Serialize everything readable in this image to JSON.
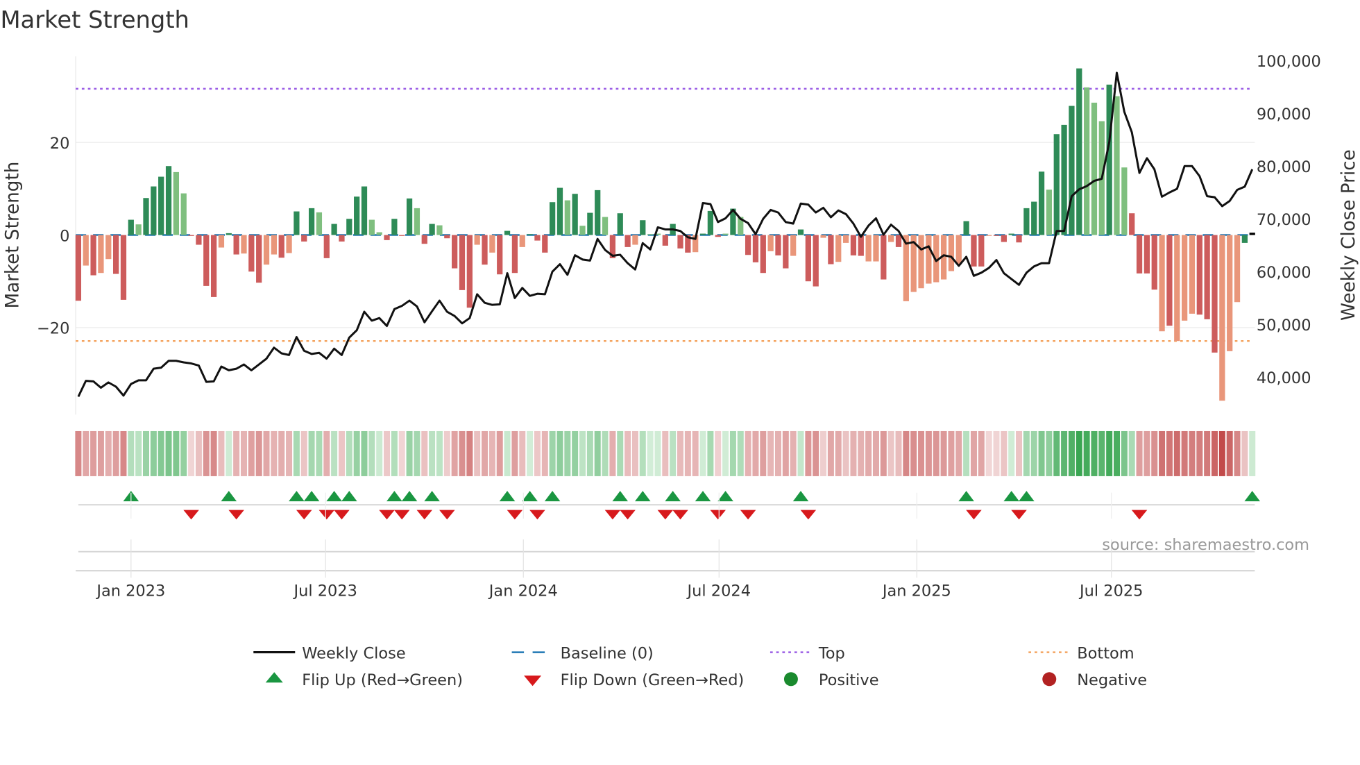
{
  "chart_data": {
    "type": "bar+line",
    "title": "Market Strength",
    "ylabel_left": "Market Strength",
    "ylabel_right": "Weekly Close Price",
    "source": "source: sharemaestro.com",
    "start_week": "2022-11-13",
    "week_days": 7,
    "ylim_left": [
      -38.8,
      38.6
    ],
    "ylim_right": [
      32900,
      100800
    ],
    "left_ticks": [
      {
        "value": 20,
        "label": "20"
      },
      {
        "value": 0,
        "label": "0"
      },
      {
        "value": -20,
        "label": "−20"
      }
    ],
    "right_ticks": [
      {
        "value": 100000,
        "label": "100,000"
      },
      {
        "value": 90000,
        "label": "90,000"
      },
      {
        "value": 80000,
        "label": "80,000"
      },
      {
        "value": 70000,
        "label": "70,000"
      },
      {
        "value": 60000,
        "label": "60,000"
      },
      {
        "value": 50000,
        "label": "50,000"
      },
      {
        "value": 40000,
        "label": "40,000"
      }
    ],
    "x_ticks": [
      {
        "date": "2023-01-01",
        "label": "Jan 2023"
      },
      {
        "date": "2023-07-01",
        "label": "Jul 2023"
      },
      {
        "date": "2024-01-01",
        "label": "Jan 2024"
      },
      {
        "date": "2024-07-01",
        "label": "Jul 2024"
      },
      {
        "date": "2025-01-01",
        "label": "Jan 2025"
      },
      {
        "date": "2025-07-01",
        "label": "Jul 2025"
      }
    ],
    "top_level": 31.6,
    "bottom_level": -22.9,
    "baseline": 0,
    "strength": [
      -14.2,
      -6.6,
      -8.7,
      -8.2,
      -5.2,
      -8.4,
      -14,
      3.3,
      2.3,
      8,
      10.5,
      12.6,
      14.9,
      13.6,
      9,
      -0.2,
      -2.1,
      -11,
      -13.4,
      -2.7,
      0.4,
      -4.2,
      -4,
      -7.9,
      -10.3,
      -6.4,
      -4.2,
      -4.9,
      -3.9,
      5.1,
      -1.4,
      5.8,
      4.9,
      -5,
      2.4,
      -1.4,
      3.5,
      8.3,
      10.5,
      3.3,
      0.6,
      -1.1,
      3.5,
      -0.2,
      7.9,
      5.8,
      -1.9,
      2.4,
      2.1,
      -0.7,
      -7.2,
      -11.9,
      -15.7,
      -2.1,
      -6.4,
      -3.8,
      -8.5,
      0.9,
      -8.2,
      -2.6,
      0.2,
      -1.2,
      -3.8,
      7.1,
      10.2,
      7.5,
      8.9,
      2,
      4.8,
      9.7,
      3.9,
      -5,
      4.7,
      -2.6,
      -2.1,
      3.2,
      0.2,
      0.3,
      -2.3,
      2.4,
      -2.9,
      -3.8,
      -3.7,
      0.3,
      5.2,
      -0.4,
      0.3,
      5.7,
      3.9,
      -4.3,
      -5.9,
      -8.2,
      -3.5,
      -4.4,
      -7.2,
      -4.5,
      1.2,
      -10,
      -11.1,
      -0.6,
      -6.3,
      -5.8,
      -1.7,
      -4.4,
      -4.5,
      -5.7,
      -5.7,
      -9.6,
      -1.5,
      -2.6,
      -14.3,
      -12.3,
      -11.5,
      -10.5,
      -10.2,
      -9.6,
      -7.8,
      -6.3,
      3,
      -6.8,
      -6.8,
      -0.1,
      -0.2,
      -1.5,
      0.3,
      -1.6,
      5.8,
      7.2,
      13.7,
      9.8,
      21.8,
      23.8,
      27.9,
      36,
      31.9,
      28.6,
      24.6,
      32.5,
      30,
      14.6,
      4.7,
      -8.3,
      -8.3,
      -11.8,
      -20.8,
      -19.6,
      -22.9,
      -18.5,
      -17,
      -17.2,
      -18.2,
      -25.4,
      -35.8,
      -25.1,
      -14.5,
      -1.7,
      0.5
    ],
    "bar_class": "RrRrrRRGgGGGGggRRRRrGRrRRrrRrGRGgRGRGGGggRGRGgRGgRRRRrRrRGRrGRRGGgGgGGgRGRrGggRGRRrGGRgGgRRRrRRrGRRrRrrRRrrRrRrrrrrrrrGRRrRRGRGGGgGGGGgggGggRRRRrRrrrRRRrrrG",
    "close": [
      36300,
      39300,
      39200,
      38000,
      39000,
      38200,
      36500,
      38700,
      39400,
      39400,
      41600,
      41800,
      43100,
      43100,
      42800,
      42600,
      42200,
      39100,
      39200,
      42000,
      41300,
      41600,
      42400,
      41300,
      42400,
      43500,
      45600,
      44500,
      44200,
      47600,
      45000,
      44400,
      44600,
      43500,
      45400,
      44200,
      47500,
      48900,
      52400,
      50700,
      51200,
      49700,
      52900,
      53500,
      54500,
      53400,
      50400,
      52500,
      54500,
      52400,
      51600,
      50200,
      51200,
      55700,
      54100,
      53700,
      53800,
      59700,
      55000,
      56900,
      55400,
      55800,
      55700,
      60000,
      61400,
      59400,
      63100,
      62300,
      62100,
      66200,
      64100,
      63000,
      63200,
      61600,
      60400,
      65400,
      64200,
      68400,
      68000,
      68000,
      67700,
      66500,
      66200,
      73000,
      72800,
      69400,
      70100,
      71700,
      70000,
      69200,
      67100,
      70000,
      71700,
      71200,
      69400,
      69100,
      72900,
      72700,
      71200,
      72100,
      70300,
      71600,
      70900,
      69100,
      66600,
      68700,
      70100,
      67000,
      68900,
      67700,
      65300,
      65600,
      64200,
      64800,
      62000,
      63100,
      62800,
      61100,
      62800,
      59200,
      59800,
      60700,
      62200,
      59700,
      58600,
      57500,
      59800,
      61000,
      61600,
      61600,
      67700,
      67700,
      74300,
      75600,
      76200,
      77200,
      77600,
      84600,
      97700,
      90300,
      86400,
      78700,
      81500,
      79400,
      74200,
      75000,
      75700,
      80000,
      80000,
      78100,
      74300,
      74100,
      72400,
      73400,
      75500,
      76100,
      79400
    ],
    "flip_up_weeks": [
      8,
      21,
      30,
      32,
      35,
      37,
      43,
      45,
      48,
      58,
      61,
      64,
      73,
      76,
      80,
      84,
      87,
      97,
      119,
      125,
      127,
      157
    ],
    "flip_down_weeks": [
      16,
      22,
      31,
      34,
      36,
      42,
      44,
      47,
      50,
      59,
      62,
      72,
      74,
      79,
      81,
      86,
      90,
      98,
      120,
      126,
      142
    ],
    "legend": {
      "weekly_close": "Weekly Close",
      "baseline": "Baseline (0)",
      "top": "Top",
      "bottom": "Bottom",
      "flip_up": "Flip Up (Red→Green)",
      "flip_down": "Flip Down (Green→Red)",
      "positive": "Positive",
      "negative": "Negative"
    },
    "colors": {
      "strong_pos": "#2e8b57",
      "weak_pos": "#7fbf7f",
      "strong_neg": "#cd5c5c",
      "weak_neg": "#e9967a",
      "close": "#111111",
      "baseline": "#1f77b4",
      "top": "#9b5de5",
      "bottom": "#f4a460",
      "flip_up": "#1a9641",
      "flip_down": "#d7191c",
      "positive": "#1a8a2e",
      "negative": "#b22222"
    }
  }
}
